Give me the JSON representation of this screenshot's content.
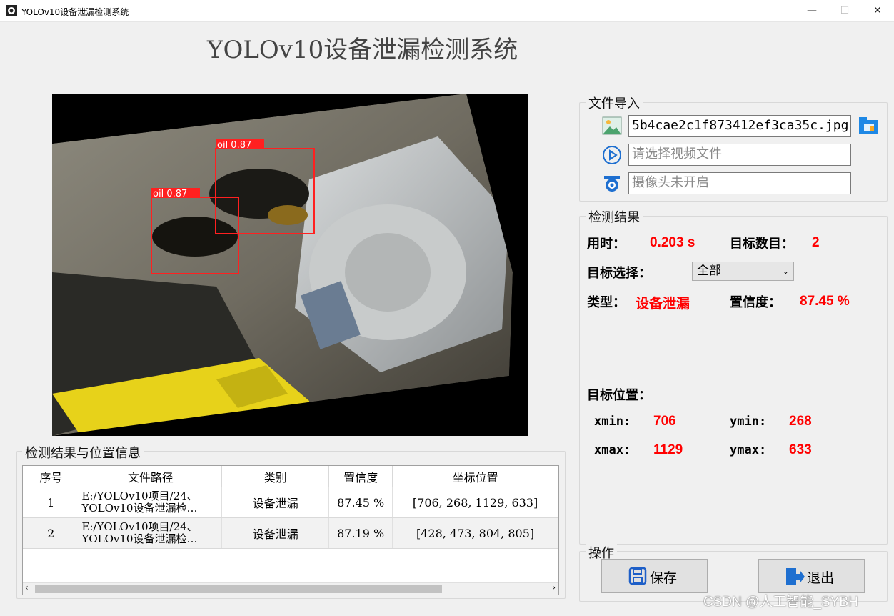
{
  "window": {
    "title": "YOLOv10设备泄漏检测系统",
    "minimize": "—",
    "maximize": "☐",
    "close": "✕"
  },
  "header": {
    "title": "YOLOv10设备泄漏检测系统"
  },
  "image": {
    "detections": [
      {
        "label": "oil 0.87"
      },
      {
        "label": "oil 0.87"
      }
    ]
  },
  "file_import": {
    "title": "文件导入",
    "image_file_value": "5b4cae2c1f873412ef3ca35c.jpg",
    "video_placeholder": "请选择视频文件",
    "camera_placeholder": "摄像头未开启"
  },
  "detection_result": {
    "title": "检测结果",
    "time_label": "用时：",
    "time_value": "0.203 s",
    "count_label": "目标数目：",
    "count_value": "2",
    "select_label": "目标选择：",
    "select_value": "全部",
    "type_label": "类型：",
    "type_value": "设备泄漏",
    "conf_label": "置信度：",
    "conf_value": "87.45 %",
    "position_label": "目标位置：",
    "xmin_label": "xmin:",
    "xmin_value": "706",
    "ymin_label": "ymin:",
    "ymin_value": "268",
    "xmax_label": "xmax:",
    "xmax_value": "1129",
    "ymax_label": "ymax:",
    "ymax_value": "633"
  },
  "results_table": {
    "title": "检测结果与位置信息",
    "headers": [
      "序号",
      "文件路径",
      "类别",
      "置信度",
      "坐标位置"
    ],
    "rows": [
      {
        "index": "1",
        "path_line1": "E:/YOLOv10项目/24、",
        "path_line2": "YOLOv10设备泄漏检…",
        "class": "设备泄漏",
        "confidence": "87.45 %",
        "coords": "[706, 268, 1129, 633]"
      },
      {
        "index": "2",
        "path_line1": "E:/YOLOv10项目/24、",
        "path_line2": "YOLOv10设备泄漏检…",
        "class": "设备泄漏",
        "confidence": "87.19 %",
        "coords": "[428, 473, 804, 805]"
      }
    ]
  },
  "operations": {
    "title": "操作",
    "save_label": "保存",
    "exit_label": "退出"
  },
  "watermark": "CSDN @人工智能_SYBH",
  "colors": {
    "detection_box": "#ff2020",
    "value_red": "#ff0000"
  }
}
